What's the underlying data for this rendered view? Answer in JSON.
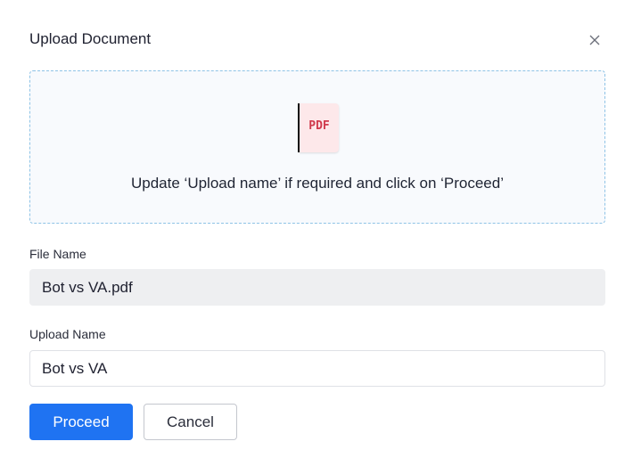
{
  "dialog": {
    "title": "Upload Document",
    "close_icon": "close-icon"
  },
  "dropzone": {
    "file_type_badge": "PDF",
    "file_icon": "pdf-file-icon",
    "message": "Update ‘Upload name’ if required and click on ‘Proceed’"
  },
  "file_name": {
    "label": "File Name",
    "value": "Bot vs VA.pdf"
  },
  "upload_name": {
    "label": "Upload Name",
    "value": "Bot vs VA"
  },
  "actions": {
    "proceed_label": "Proceed",
    "cancel_label": "Cancel"
  },
  "colors": {
    "primary": "#1f73f2",
    "pdf_badge_bg": "#fde8ea",
    "pdf_badge_text": "#d03a4c",
    "dropzone_border": "#8ec3e6",
    "readonly_field_bg": "#eeeff1"
  }
}
